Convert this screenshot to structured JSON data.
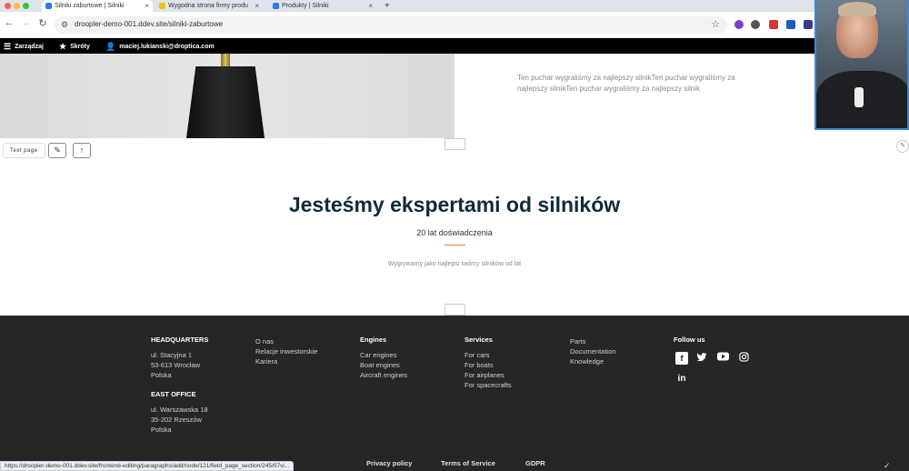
{
  "browser": {
    "tabs": [
      {
        "label": "Silniki zaburtowe | Silniki",
        "active": true
      },
      {
        "label": "Wygodna strona firmy produ",
        "active": false
      },
      {
        "label": "Produkty | Silniki",
        "active": false
      }
    ],
    "new_tab": "+",
    "url": "droopler-demo-001.ddev.site/silniki-zaburtowe",
    "icons": [
      "back-icon",
      "forward-icon",
      "reload-icon",
      "star-icon",
      "close-icon"
    ]
  },
  "admin_toolbar": {
    "manage": "Zarządzaj",
    "shortcuts": "Skróty",
    "user": "maciej.lukianski@droptica.com"
  },
  "content": {
    "side_text": "Ten puchar wygraliśmy za najlepszy silnikTen puchar wygraliśmy za najlepszy silnikTen puchar wygraliśmy za najlepszy silnik",
    "paragraph_type": "Text page",
    "heading": "Jesteśmy ekspertami od silników",
    "subheading": "20 lat doświadczenia",
    "description": "Wygrywamy jako najlepsi twórcy silników od lat",
    "accent_color": "#e98a34",
    "heading_color": "#0f2a3a"
  },
  "footer": {
    "headquarters": {
      "title": "HEADQUARTERS",
      "lines": [
        "ul. Stacyjna 1",
        "53-613 Wrocław",
        "Polska"
      ]
    },
    "east_office": {
      "title": "EAST OFFICE",
      "lines": [
        "ul. Warszawska 18",
        "35-202 Rzeszów",
        "Polska"
      ]
    },
    "company": [
      "O nas",
      "Relacje inwestorskie",
      "Kariera"
    ],
    "engines": {
      "title": "Engines",
      "links": [
        "Car engines",
        "Boat engines",
        "Aircraft engines"
      ]
    },
    "services": {
      "title": "Services",
      "links": [
        "For cars",
        "For boats",
        "For airplanes",
        "For spacecrafts"
      ]
    },
    "resources": [
      "Parts",
      "Documentation",
      "Knowledge"
    ],
    "follow": {
      "title": "Follow us",
      "icons": [
        "facebook-icon",
        "twitter-icon",
        "youtube-icon",
        "instagram-icon",
        "linkedin-icon"
      ]
    },
    "legal": [
      "Privacy policy",
      "Terms of Service",
      "GDPR"
    ],
    "background": "#262626"
  },
  "status_url": "https://droopler-demo-001.ddev.site/frontend-editing/paragraphs/add/node/121/field_page_section/245/07vi..."
}
